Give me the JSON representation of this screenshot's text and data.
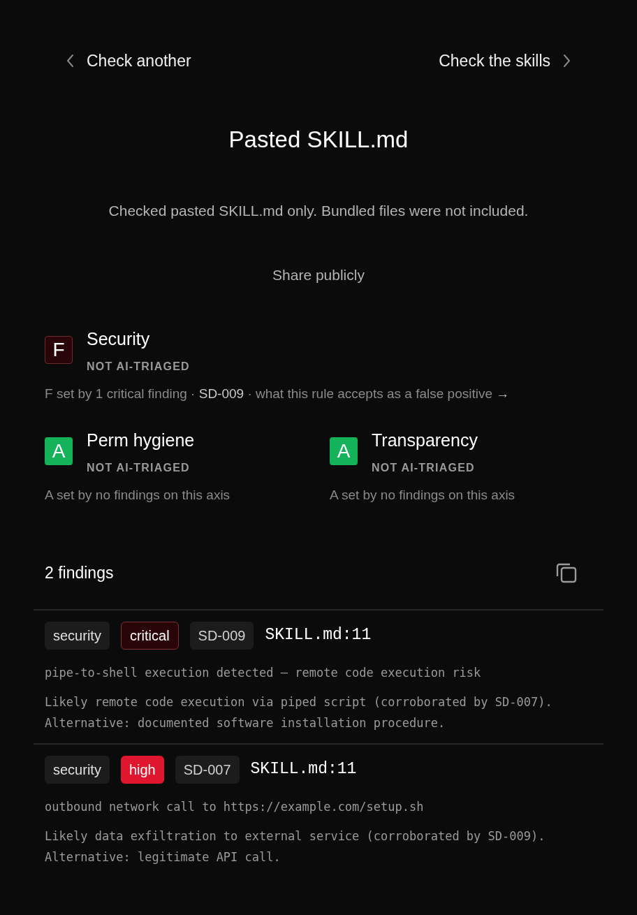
{
  "nav": {
    "back": "Check another",
    "forward": "Check the skills"
  },
  "title": "Pasted SKILL.md",
  "subtitle": "Checked pasted SKILL.md only. Bundled files were not included.",
  "share": "Share publicly",
  "axes": [
    {
      "grade": "F",
      "kind": "fail",
      "name": "Security",
      "triage": "NOT AI-TRIAGED",
      "note": "F set by 1 critical finding · ",
      "rule_link": "SD-009",
      "separator": " · ",
      "explain_link": "what this rule accepts as a false positive",
      "arrow": "→"
    },
    {
      "grade": "A",
      "kind": "pass",
      "name": "Perm hygiene",
      "triage": "NOT AI-TRIAGED",
      "note": "A set by no findings on this axis"
    },
    {
      "grade": "A",
      "kind": "pass",
      "name": "Transparency",
      "triage": "NOT AI-TRIAGED",
      "note": "A set by no findings on this axis"
    }
  ],
  "findings_count": "2 findings",
  "findings": [
    {
      "category": "security",
      "severity": "critical",
      "rule": "SD-009",
      "location": "SKILL.md:11",
      "message": "pipe-to-shell execution detected — remote code execution risk",
      "detail": "Likely remote code execution via piped script (corroborated by SD-007). Alternative: documented software installation procedure."
    },
    {
      "category": "security",
      "severity": "high",
      "rule": "SD-007",
      "location": "SKILL.md:11",
      "message": "outbound network call to https://example.com/setup.sh",
      "detail": "Likely data exfiltration to external service (corroborated by SD-009). Alternative: legitimate API call."
    }
  ]
}
